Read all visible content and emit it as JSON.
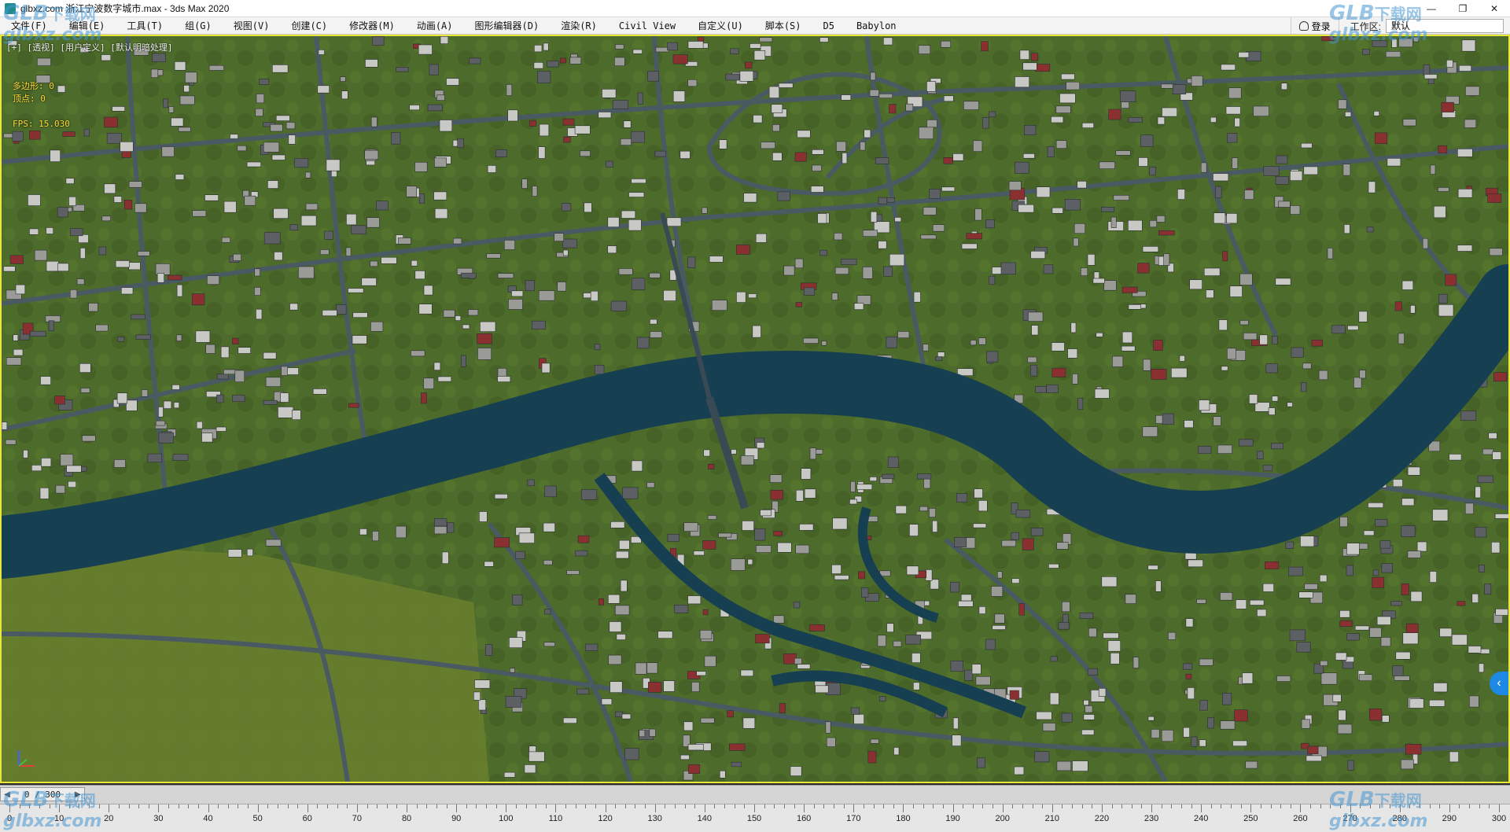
{
  "window": {
    "title": "glbxz.com 浙江宁波数字城市.max - 3ds Max 2020",
    "controls": {
      "minimize": "—",
      "maximize": "❐",
      "close": "✕"
    }
  },
  "menu": [
    "文件(F)",
    "编辑(E)",
    "工具(T)",
    "组(G)",
    "视图(V)",
    "创建(C)",
    "修改器(M)",
    "动画(A)",
    "图形编辑器(D)",
    "渲染(R)",
    "Civil View",
    "自定义(U)",
    "脚本(S)",
    "D5",
    "Babylon"
  ],
  "account": {
    "login_label": "登录",
    "workspace_label": "工作区:",
    "workspace_value": "默认"
  },
  "viewport": {
    "label": "[+] [透视] [用户定义] [默认明暗处理]",
    "stats": {
      "polys": "多边形: 0",
      "verts": "顶点: 0",
      "fps": "FPS:  15.030"
    },
    "expand_glyph": "‹"
  },
  "timeline": {
    "frame": "0 / 300",
    "ticks": [
      "0",
      "10",
      "20",
      "30",
      "40",
      "50",
      "60",
      "70",
      "80",
      "90",
      "100",
      "110",
      "120",
      "130",
      "140",
      "150",
      "160",
      "170",
      "180",
      "190",
      "200",
      "210",
      "220",
      "230",
      "240",
      "250",
      "260",
      "270",
      "280",
      "290",
      "300"
    ]
  },
  "watermarks": {
    "brand": "GLB",
    "cn": "下载网",
    "url": "glbxz.com"
  },
  "colors": {
    "viewport_border": "#e8e83a",
    "water": "#173f52",
    "riverbank": "#3ec3dc",
    "land": "#4d6b2a",
    "road": "#4a5a62",
    "accent": "#1e88e5"
  }
}
